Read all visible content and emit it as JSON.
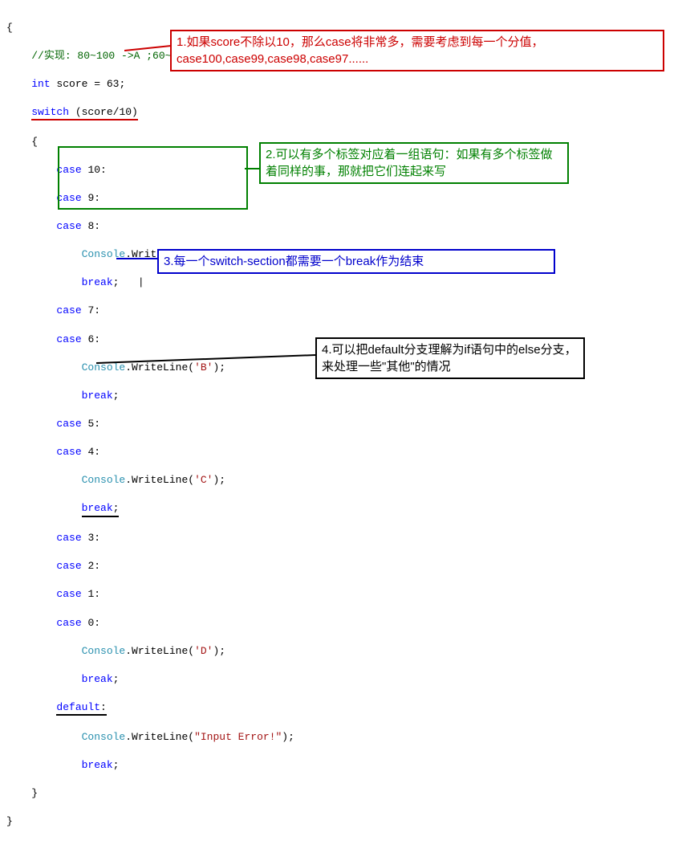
{
  "code": {
    "l01": "{",
    "l02_pre": "    ",
    "l02": "//实现: 80~100 ->A ;60~79 ->B ; 40~59 ->C ; 0~39 -> D",
    "l03_pre": "    ",
    "l03_kw": "int",
    "l03_rest": " score = 63;",
    "l04_pre": "    ",
    "l04_kw": "switch",
    "l04_rest": " (score/10)",
    "l05": "    {",
    "l06_pre": "        ",
    "l06_kw": "case",
    "l06_rest": " 10:",
    "l07_pre": "        ",
    "l07_kw": "case",
    "l07_rest": " 9:",
    "l08_pre": "        ",
    "l08_kw": "case",
    "l08_rest": " 8:",
    "l09_pre": "            ",
    "l09_cls": "Console",
    "l09_mid": ".WriteLine(",
    "l09_str": "'A'",
    "l09_end": ");",
    "l10_pre": "            ",
    "l10_kw": "break",
    "l10_rest": ";",
    "l10_cursor": "   |",
    "l11_pre": "        ",
    "l11_kw": "case",
    "l11_rest": " 7:",
    "l12_pre": "        ",
    "l12_kw": "case",
    "l12_rest": " 6:",
    "l13_pre": "            ",
    "l13_cls": "Console",
    "l13_mid": ".WriteLine(",
    "l13_str": "'B'",
    "l13_end": ");",
    "l14_pre": "            ",
    "l14_kw": "break",
    "l14_rest": ";",
    "l15_pre": "        ",
    "l15_kw": "case",
    "l15_rest": " 5:",
    "l16_pre": "        ",
    "l16_kw": "case",
    "l16_rest": " 4:",
    "l17_pre": "            ",
    "l17_cls": "Console",
    "l17_mid": ".WriteLine(",
    "l17_str": "'C'",
    "l17_end": ");",
    "l18_pre": "            ",
    "l18_kw": "break",
    "l18_rest": ";",
    "l19_pre": "        ",
    "l19_kw": "case",
    "l19_rest": " 3:",
    "l20_pre": "        ",
    "l20_kw": "case",
    "l20_rest": " 2:",
    "l21_pre": "        ",
    "l21_kw": "case",
    "l21_rest": " 1:",
    "l22_pre": "        ",
    "l22_kw": "case",
    "l22_rest": " 0:",
    "l23_pre": "            ",
    "l23_cls": "Console",
    "l23_mid": ".WriteLine(",
    "l23_str": "'D'",
    "l23_end": ");",
    "l24_pre": "            ",
    "l24_kw": "break",
    "l24_rest": ";",
    "l25_pre": "        ",
    "l25_kw": "default",
    "l25_rest": ":",
    "l26_pre": "            ",
    "l26_cls": "Console",
    "l26_mid": ".WriteLine(",
    "l26_str": "\"Input Error!\"",
    "l26_end": ");",
    "l27_pre": "            ",
    "l27_kw": "break",
    "l27_rest": ";",
    "l28": "    }",
    "l29": "}"
  },
  "annot": {
    "a1": "1.如果score不除以10，那么case将非常多，需要考虑到每一个分值，case100,case99,case98,case97......",
    "a2": "2.可以有多个标签对应着一组语句：如果有多个标签做着同样的事，那就把它们连起来写",
    "a3": "3.每一个switch-section都需要一个break作为结束",
    "a4": "4.可以把default分支理解为if语句中的else分支，来处理一些\"其他\"的情况"
  }
}
